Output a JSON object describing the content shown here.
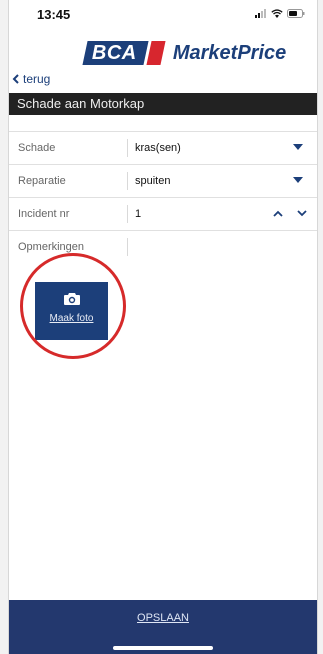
{
  "status_bar": {
    "time": "13:45"
  },
  "logo": {
    "bca": "BCA",
    "market_price": "MarketPrice"
  },
  "nav": {
    "back_label": "terug"
  },
  "header": {
    "title": "Schade aan Motorkap"
  },
  "form": {
    "schade": {
      "label": "Schade",
      "value": "kras(sen)"
    },
    "reparatie": {
      "label": "Reparatie",
      "value": "spuiten"
    },
    "incident": {
      "label": "Incident nr",
      "value": "1"
    },
    "opmerkingen": {
      "label": "Opmerkingen",
      "value": ""
    }
  },
  "photo": {
    "label": "Maak foto"
  },
  "footer": {
    "save_label": "OPSLAAN"
  },
  "colors": {
    "brand_blue": "#1c3f7a",
    "brand_red": "#d7262e",
    "footer_blue": "#23386e",
    "highlight_circle": "#d62a2a"
  }
}
